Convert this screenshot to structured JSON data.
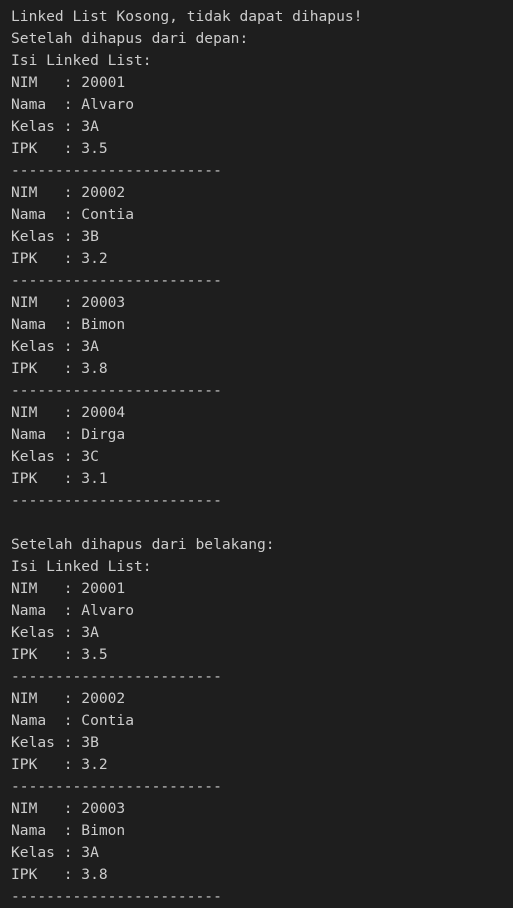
{
  "terminal": {
    "lines": [
      "Linked List Kosong, tidak dapat dihapus!",
      "Setelah dihapus dari depan:",
      "Isi Linked List:",
      "NIM   : 20001",
      "Nama  : Alvaro",
      "Kelas : 3A",
      "IPK   : 3.5",
      "------------------------",
      "NIM   : 20002",
      "Nama  : Contia",
      "Kelas : 3B",
      "IPK   : 3.2",
      "------------------------",
      "NIM   : 20003",
      "Nama  : Bimon",
      "Kelas : 3A",
      "IPK   : 3.8",
      "------------------------",
      "NIM   : 20004",
      "Nama  : Dirga",
      "Kelas : 3C",
      "IPK   : 3.1",
      "------------------------",
      "",
      "Setelah dihapus dari belakang:",
      "Isi Linked List:",
      "NIM   : 20001",
      "Nama  : Alvaro",
      "Kelas : 3A",
      "IPK   : 3.5",
      "------------------------",
      "NIM   : 20002",
      "Nama  : Contia",
      "Kelas : 3B",
      "IPK   : 3.2",
      "------------------------",
      "NIM   : 20003",
      "Nama  : Bimon",
      "Kelas : 3A",
      "IPK   : 3.8",
      "------------------------"
    ]
  }
}
